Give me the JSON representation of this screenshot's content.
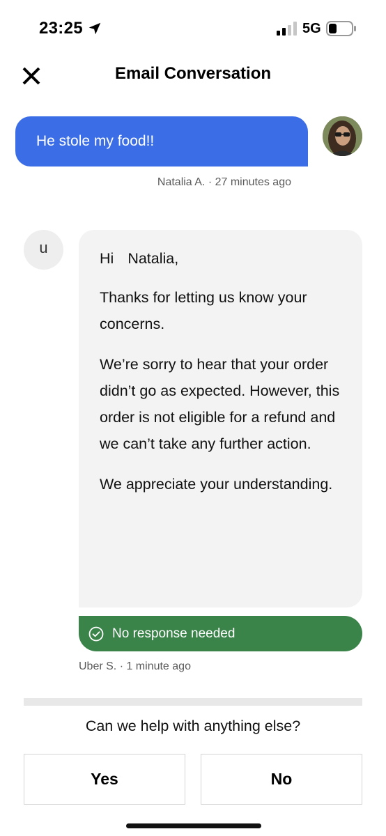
{
  "status_bar": {
    "time": "23:25",
    "network": "5G",
    "icons": [
      "location-arrow-icon",
      "signal-icon",
      "battery-icon"
    ]
  },
  "header": {
    "title": "Email Conversation",
    "close_icon": "close-icon"
  },
  "conversation": {
    "outgoing": {
      "text": "He stole my food!!",
      "meta": "Natalia A. · 27 minutes ago",
      "bubble_color": "#3b6ee6"
    },
    "incoming": {
      "avatar_letter": "u",
      "greeting_hi": "Hi",
      "greeting_name": "Natalia,",
      "paragraphs": [
        "Thanks for letting us know your concerns.",
        "We’re sorry to hear that your order didn’t go as expected. However, this order is not eligible for a refund and we can’t take any further action.",
        "We appreciate your understanding."
      ],
      "badge": "No response needed",
      "badge_color": "#3a8349",
      "meta": "Uber S. · 1 minute ago"
    }
  },
  "footer": {
    "question": "Can we help with anything else?",
    "yes_label": "Yes",
    "no_label": "No"
  }
}
